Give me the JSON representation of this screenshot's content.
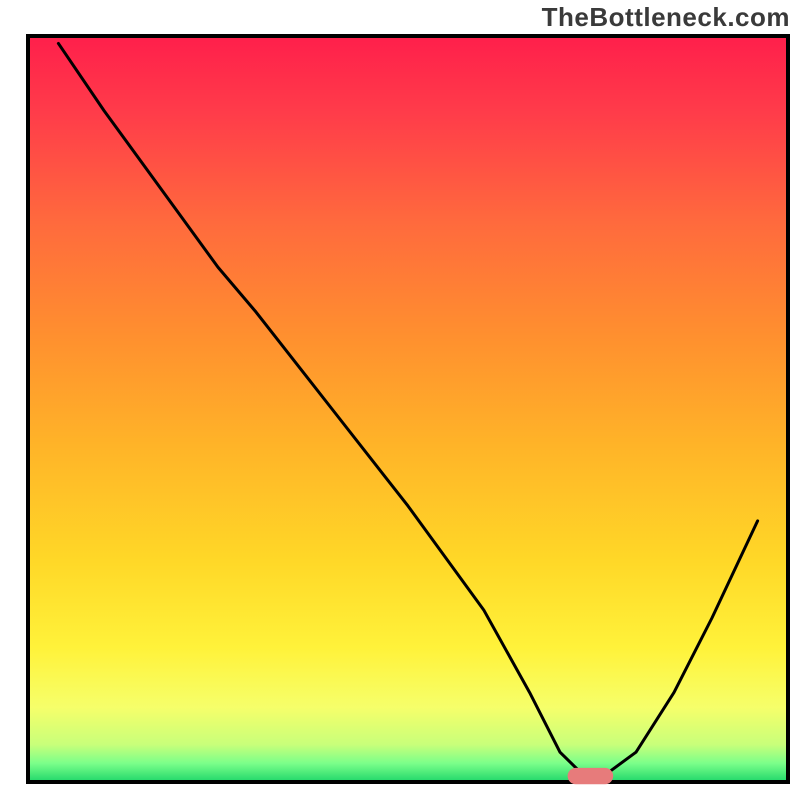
{
  "watermark": "TheBottleneck.com",
  "chart_data": {
    "type": "line",
    "title": "",
    "xlabel": "",
    "ylabel": "",
    "xlim": [
      0,
      100
    ],
    "ylim": [
      0,
      100
    ],
    "series": [
      {
        "name": "bottleneck-curve",
        "x": [
          4,
          10,
          20,
          25,
          30,
          40,
          50,
          60,
          66,
          70,
          73,
          76,
          80,
          85,
          90,
          96
        ],
        "y": [
          99,
          90,
          76,
          69,
          63,
          50,
          37,
          23,
          12,
          4,
          1,
          1,
          4,
          12,
          22,
          35
        ]
      }
    ],
    "marker": {
      "name": "optimal-range",
      "x_center": 74,
      "y": 0.8,
      "width": 6,
      "height": 2.2,
      "color": "#e77b7b"
    },
    "gradient_stops": [
      {
        "offset": 0.0,
        "color": "#ff1f4b"
      },
      {
        "offset": 0.1,
        "color": "#ff3b4a"
      },
      {
        "offset": 0.25,
        "color": "#ff6a3d"
      },
      {
        "offset": 0.4,
        "color": "#ff8f2f"
      },
      {
        "offset": 0.55,
        "color": "#ffb428"
      },
      {
        "offset": 0.7,
        "color": "#ffd727"
      },
      {
        "offset": 0.82,
        "color": "#fff23a"
      },
      {
        "offset": 0.9,
        "color": "#f6ff6a"
      },
      {
        "offset": 0.95,
        "color": "#c8ff7a"
      },
      {
        "offset": 0.975,
        "color": "#7bff8a"
      },
      {
        "offset": 1.0,
        "color": "#1fd66a"
      }
    ],
    "frame_color": "#000000",
    "curve_color": "#000000"
  }
}
